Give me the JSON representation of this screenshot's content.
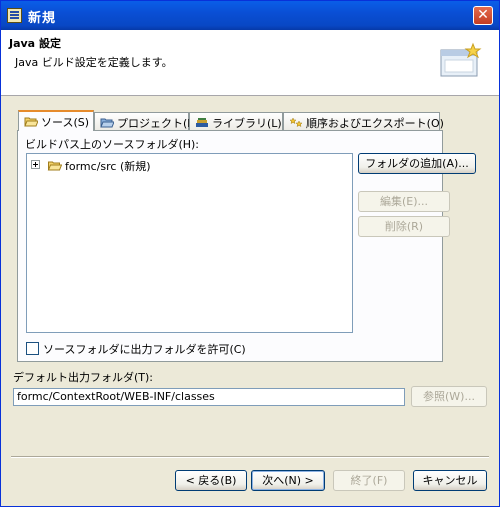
{
  "window": {
    "title": "新規"
  },
  "header": {
    "title": "Java 設定",
    "description": "Java ビルド設定を定義します。"
  },
  "tabs": [
    {
      "label": "ソース(S)",
      "icon": "folder-open-icon"
    },
    {
      "label": "プロジェクト(P)",
      "icon": "project-folder-icon"
    },
    {
      "label": "ライブラリ(L)",
      "icon": "library-books-icon"
    },
    {
      "label": "順序およびエクスポート(O)",
      "icon": "order-export-icon"
    }
  ],
  "source": {
    "tree_label": "ビルドパス上のソースフォルダ(H):",
    "tree_items": [
      {
        "label": "formc/src (新規)"
      }
    ],
    "add_folder": "フォルダの追加(A)...",
    "edit": "編集(E)...",
    "remove": "削除(R)",
    "allow_output_label": "ソースフォルダに出力フォルダを許可(C)",
    "allow_output_checked": false
  },
  "output": {
    "label": "デフォルト出力フォルダ(T):",
    "value": "formc/ContextRoot/WEB-INF/classes",
    "browse": "参照(W)..."
  },
  "footer": {
    "back": "< 戻る(B)",
    "next": "次へ(N) >",
    "finish": "終了(F)",
    "cancel": "キャンセル"
  }
}
